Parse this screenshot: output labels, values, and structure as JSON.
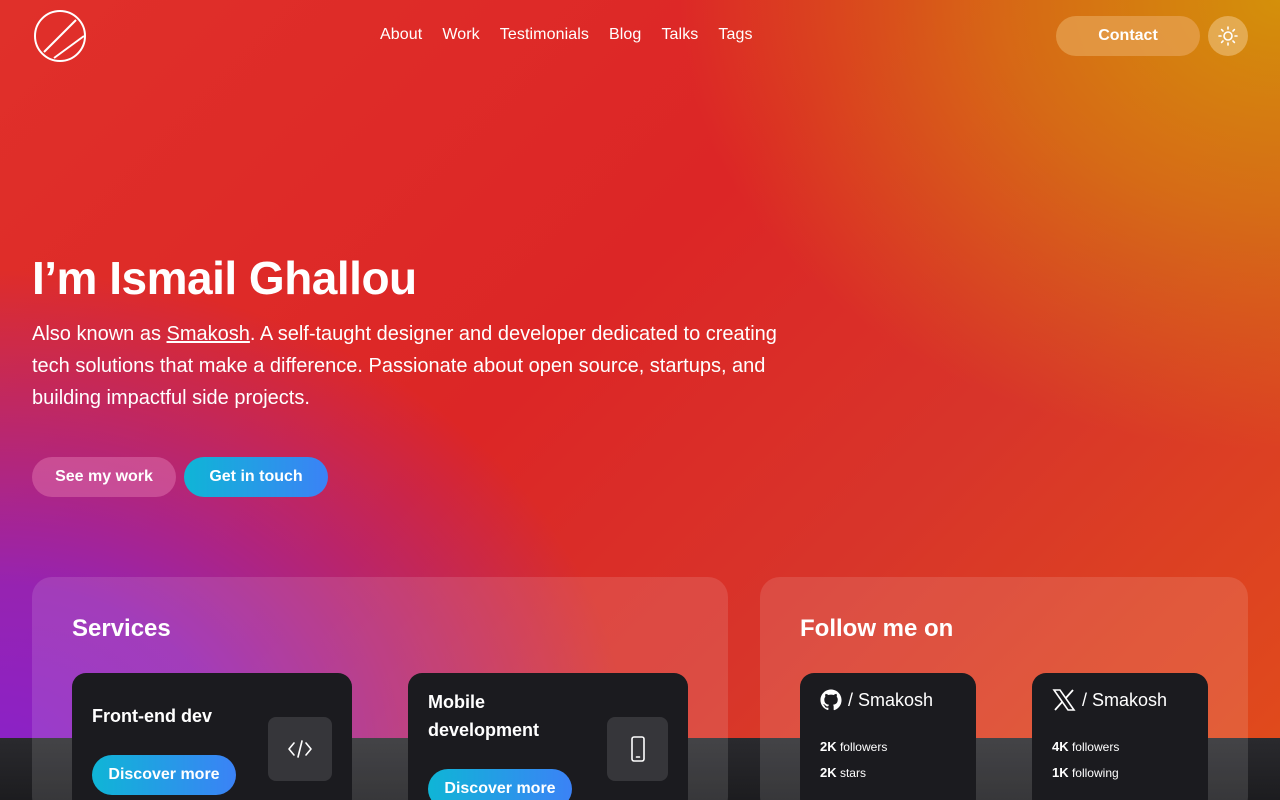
{
  "header": {
    "nav": [
      "About",
      "Work",
      "Testimonials",
      "Blog",
      "Talks",
      "Tags"
    ],
    "contact_label": "Contact"
  },
  "hero": {
    "title": "I’m Ismail Ghallou",
    "text_prefix": "Also known as ",
    "text_link": "Smakosh",
    "text_suffix": ". A self-taught designer and developer dedicated to creating tech solutions that make a difference. Passionate about open source, startups, and building impactful side projects.",
    "primary_label": "See my work",
    "secondary_label": "Get in touch"
  },
  "services": {
    "title": "Services",
    "items": [
      {
        "title": "Front-end dev",
        "button": "Discover more",
        "icon": "code-icon"
      },
      {
        "title": "Mobile development",
        "button": "Discover more",
        "icon": "smartphone-icon"
      }
    ]
  },
  "follow": {
    "title": "Follow me on",
    "accounts": [
      {
        "icon": "github-icon",
        "handle": "/ Smakosh",
        "stat1_value": "2K",
        "stat1_label": "followers",
        "stat2_value": "2K",
        "stat2_label": "stars"
      },
      {
        "icon": "x-icon",
        "handle": "/ Smakosh",
        "stat1_value": "4K",
        "stat1_label": "followers",
        "stat2_value": "1K",
        "stat2_label": "following"
      }
    ]
  },
  "colors": {
    "accent_gradient_start": "#0fb5d6",
    "accent_gradient_end": "#3b82f6",
    "card_bg": "#1b1b1f"
  }
}
